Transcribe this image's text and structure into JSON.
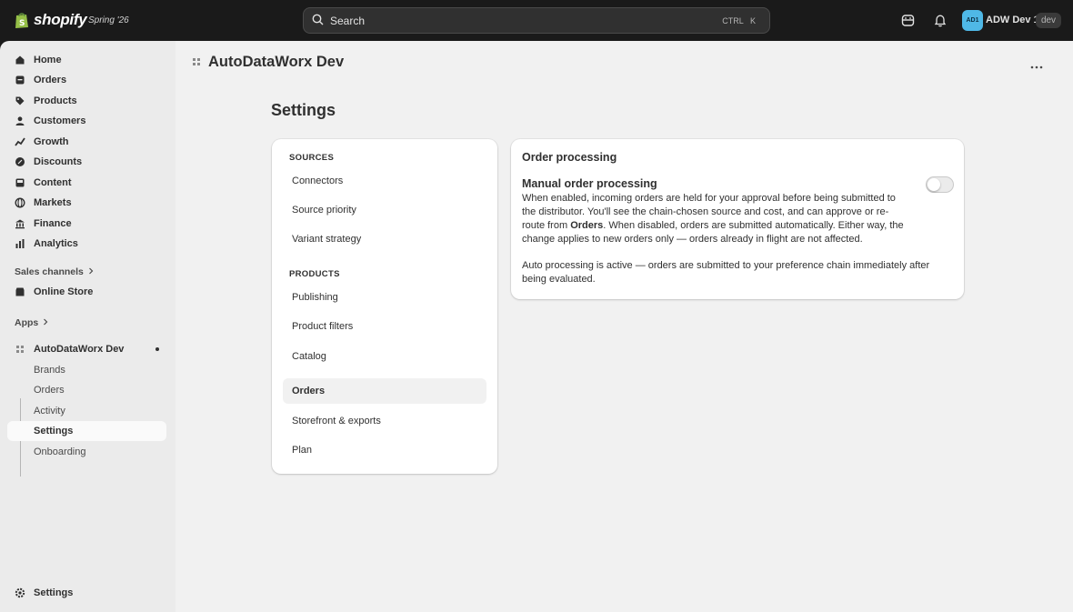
{
  "topbar": {
    "brand": "shopify",
    "edition": "Spring '26",
    "search_placeholder": "Search",
    "shortcut_ctrl": "CTRL",
    "shortcut_k": "K",
    "avatar_initials": "AD1",
    "store_name": "ADW Dev 1",
    "env_badge": "dev"
  },
  "sidebar": {
    "items": [
      {
        "label": "Home",
        "icon": "home-icon"
      },
      {
        "label": "Orders",
        "icon": "orders-icon"
      },
      {
        "label": "Products",
        "icon": "tag-icon"
      },
      {
        "label": "Customers",
        "icon": "person-icon"
      },
      {
        "label": "Growth",
        "icon": "chart-icon"
      },
      {
        "label": "Discounts",
        "icon": "discount-icon"
      },
      {
        "label": "Content",
        "icon": "content-icon"
      },
      {
        "label": "Markets",
        "icon": "globe-icon"
      },
      {
        "label": "Finance",
        "icon": "bank-icon"
      },
      {
        "label": "Analytics",
        "icon": "analytics-icon"
      }
    ],
    "sales_channels_label": "Sales channels",
    "online_store_label": "Online Store",
    "apps_label": "Apps",
    "app_name": "AutoDataWorx Dev",
    "app_subitems": [
      "Brands",
      "Orders",
      "Activity",
      "Settings",
      "Onboarding"
    ],
    "footer_settings": "Settings"
  },
  "main": {
    "app_title": "AutoDataWorx Dev",
    "page_title": "Settings",
    "nav_groups": [
      {
        "heading": "SOURCES",
        "links": [
          "Connectors",
          "Source priority",
          "Variant strategy"
        ]
      },
      {
        "heading": "PRODUCTS",
        "links": [
          "Publishing",
          "Product filters",
          "Catalog",
          "Orders",
          "Storefront & exports",
          "Plan"
        ]
      }
    ],
    "card": {
      "title": "Order processing",
      "subtitle": "Manual order processing",
      "p1_line1": "When enabled, incoming orders are held for your approval before being submitted to",
      "p1_line2": "the distributor. You'll see the chain-chosen source and cost, and can approve or re-",
      "p1_line3_a": "route from ",
      "p1_line3_bold": "Orders",
      "p1_line3_b": ". When disabled, orders are submitted automatically. Either way, the",
      "p1_line4": "change applies to new orders only — orders already in flight are not affected.",
      "p2_line1": "Auto processing is active — orders are submitted to your preference chain immediately after",
      "p2_line2": "being evaluated.",
      "toggle_on": false
    }
  }
}
